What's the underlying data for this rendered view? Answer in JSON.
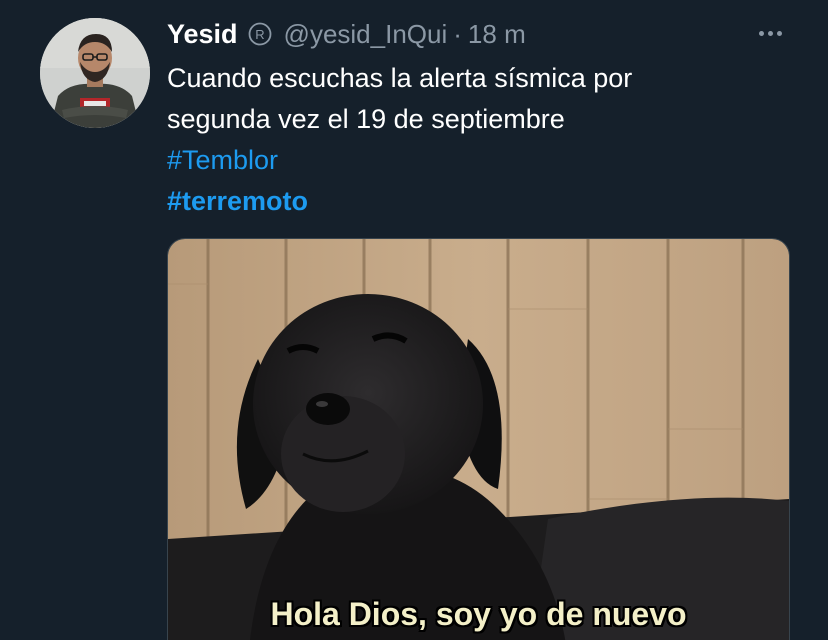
{
  "tweet": {
    "display_name": "Yesid",
    "badge_icon": "registered-icon",
    "handle": "@yesid_InQui",
    "separator": "·",
    "time": "18 m",
    "more_icon": "more-options-icon",
    "text_lines": [
      "Cuando escuchas la alerta sísmica por",
      "segunda vez el 19 de septiembre"
    ],
    "hashtags": [
      "#Temblor",
      "#terremoto"
    ],
    "media": {
      "caption": "Hola Dios, soy yo de nuevo"
    }
  },
  "colors": {
    "background": "#15202b",
    "text": "#ffffff",
    "secondary_text": "#8b98a5",
    "link": "#1d9bf0"
  }
}
